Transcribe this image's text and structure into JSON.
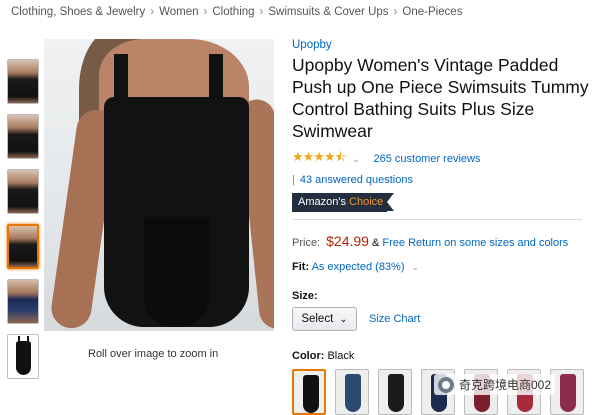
{
  "breadcrumb": [
    "Clothing, Shoes & Jewelry",
    "Women",
    "Clothing",
    "Swimsuits & Cover Ups",
    "One-Pieces"
  ],
  "gallery": {
    "thumbnails": [
      "Black swimsuit front view",
      "Black swimsuit side view",
      "Black swimsuit back view",
      "Black swimsuit selected view",
      "Navy swimsuit view",
      "Black swimsuit product-only view"
    ],
    "selected_index": 3,
    "zoom_hint": "Roll over image to zoom in"
  },
  "product": {
    "brand": "Upopby",
    "title": "Upopby Women's Vintage Padded Push up One Piece Swimsuits Tummy Control Bathing Suits Plus Size Swimwear",
    "rating": 4.5,
    "stars_text": "★★★★⯪",
    "reviews_link": "265 customer reviews",
    "qa_separator": "|",
    "questions_link": "43 answered questions",
    "badge_prefix": "Amazon's",
    "badge_suffix": "Choice",
    "price_label": "Price:",
    "price": "$24.99",
    "price_amp": "&",
    "return_link": "Free Return on some sizes and colors",
    "fit_label": "Fit:",
    "fit_value": "As expected (83%)",
    "size_label": "Size:",
    "size_select": "Select",
    "size_chart_link": "Size Chart",
    "color_label": "Color:",
    "color_value": "Black",
    "swatch_colors": [
      "#111111",
      "#2c4a6e",
      "#1a1a1a",
      "#1c2a4f",
      "#7a1f2b",
      "#a62a3a",
      "#8b2d4a"
    ]
  },
  "watermark": "奇克跨境电商002",
  "colors": {
    "link": "#0066c0",
    "price": "#b12704",
    "selected": "#e77600",
    "star": "#f0a81a",
    "badge": "#232f3e",
    "badge_accent": "#f69931"
  }
}
